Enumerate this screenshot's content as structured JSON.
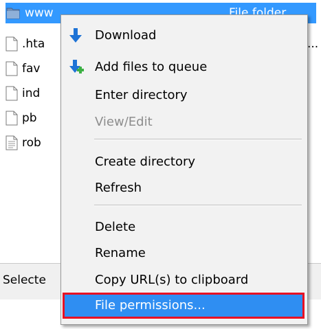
{
  "file_list": {
    "rows": [
      {
        "name": "www",
        "type": "File folder",
        "icon": "folder-icon",
        "selected": true
      },
      {
        "name": ".hta",
        "type": "...",
        "icon": "document-icon"
      },
      {
        "name": "fav",
        "type": "",
        "icon": "document-icon"
      },
      {
        "name": "ind",
        "type": "",
        "icon": "document-icon"
      },
      {
        "name": "pb",
        "type": "",
        "icon": "document-icon"
      },
      {
        "name": "rob",
        "type": "",
        "icon": "text-document-icon"
      }
    ]
  },
  "status_bar": {
    "text": "Selecte"
  },
  "context_menu": {
    "items": {
      "download": "Download",
      "add_to_queue": "Add files to queue",
      "enter_directory": "Enter directory",
      "view_edit": "View/Edit",
      "create_directory": "Create directory",
      "refresh": "Refresh",
      "delete": "Delete",
      "rename": "Rename",
      "copy_url": "Copy URL(s) to clipboard",
      "file_permissions": "File permissions..."
    }
  },
  "colors": {
    "selection": "#3399ff",
    "menu_background": "#f2f2f2",
    "highlight": "#2f8ef2",
    "highlight_border": "#e81123",
    "disabled_text": "#8d8d8d"
  }
}
